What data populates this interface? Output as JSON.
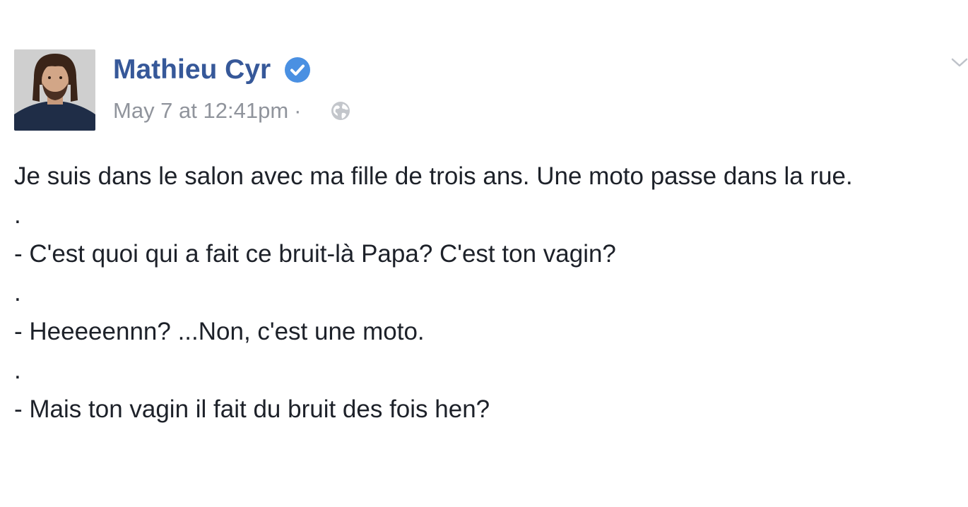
{
  "post": {
    "author": {
      "name": "Mathieu Cyr",
      "verified": true,
      "avatar_icon": "profile-photo"
    },
    "meta": {
      "timestamp": "May 7 at 12:41pm",
      "separator": "·",
      "audience_icon": "globe-icon"
    },
    "menu_icon": "chevron-down-icon",
    "lines": [
      "Je suis dans le salon avec ma fille de trois ans. Une moto passe dans la rue.",
      ".",
      "- C'est quoi qui a fait ce bruit-là Papa? C'est ton vagin?",
      ".",
      "- Heeeeennn? ...Non, c'est une moto.",
      ".",
      "- Mais ton vagin il fait du bruit des fois hen?"
    ]
  },
  "colors": {
    "author_link": "#365899",
    "meta_gray": "#90949c",
    "text": "#1d2129",
    "verified_blue": "#4a90e2"
  }
}
